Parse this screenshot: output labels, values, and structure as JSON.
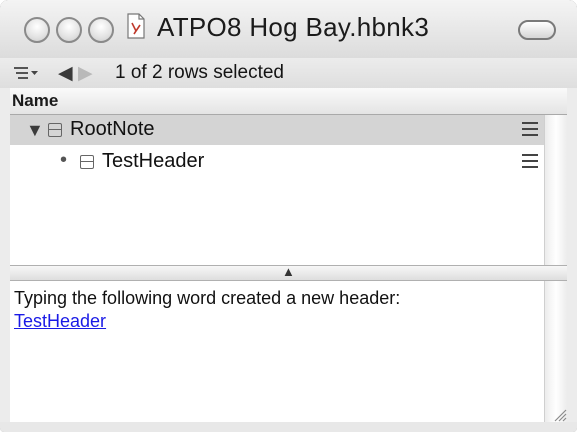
{
  "window": {
    "title": "ATPO8 Hog Bay.hbnk3",
    "controls": [
      "close-button",
      "minimize-button",
      "zoom-button"
    ],
    "document_icon": "document-icon",
    "toolbar_toggle_icon": "toolbar-toggle-icon"
  },
  "toolbar": {
    "menu_icon": "outline-menu-icon",
    "back_icon": "left-arrow-icon",
    "forward_icon": "right-arrow-icon",
    "status": "1 of 2 rows selected"
  },
  "outline": {
    "column_header": "Name",
    "rows": [
      {
        "label": "RootNote",
        "expanded": true,
        "selected": true,
        "icon": "note-icon"
      },
      {
        "label": "TestHeader",
        "expanded": false,
        "selected": false,
        "icon": "note-icon"
      }
    ]
  },
  "note": {
    "text": "Typing the following word created a new header:",
    "link": "TestHeader",
    "link_color": "#1a1ae6"
  },
  "colors": {
    "selection": "#d4d4d4",
    "window_bg": "#f2f2f2"
  }
}
